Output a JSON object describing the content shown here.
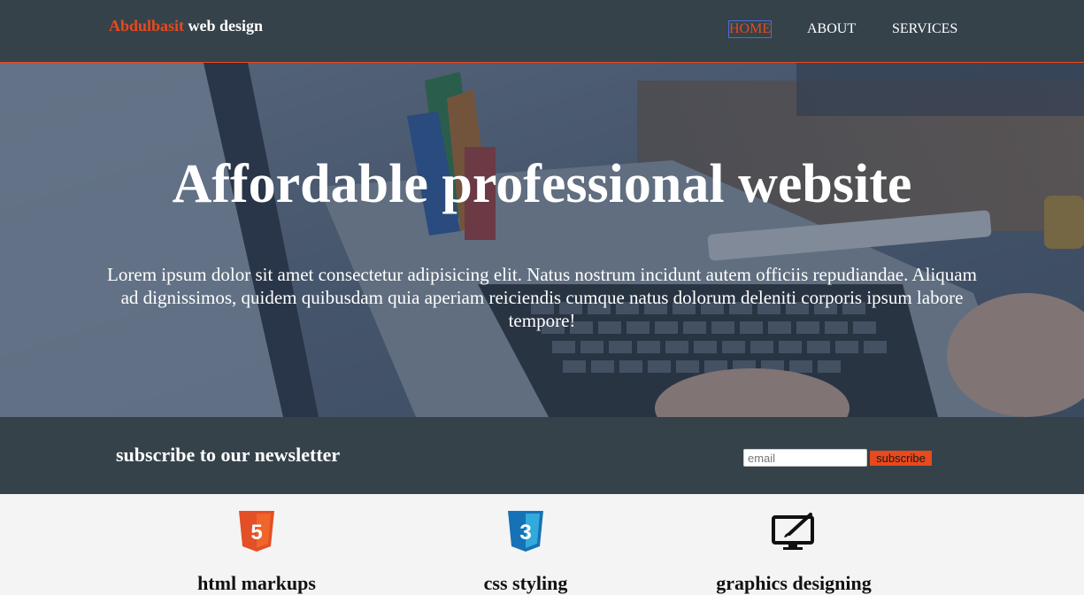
{
  "header": {
    "brand_highlight": "Abdulbasit",
    "brand_rest": " web design",
    "nav": [
      {
        "label": "HOME",
        "current": true
      },
      {
        "label": "ABOUT",
        "current": false
      },
      {
        "label": "SERVICES",
        "current": false
      }
    ]
  },
  "hero": {
    "title": "Affordable professional website",
    "text": "Lorem ipsum dolor sit amet consectetur adipisicing elit. Natus nostrum incidunt autem officiis repudiandae. Aliquam ad dignissimos, quidem quibusdam quia aperiam reiciendis cumque natus dolorum deleniti corporis ipsum labore tempore!"
  },
  "newsletter": {
    "heading": "subscribe to our newsletter",
    "email_placeholder": "email",
    "button_label": "subscribe"
  },
  "boxes": [
    {
      "icon": "html5-icon",
      "title": "html markups"
    },
    {
      "icon": "css3-icon",
      "title": "css styling"
    },
    {
      "icon": "graphics-monitor-icon",
      "title": "graphics designing"
    }
  ],
  "colors": {
    "dark": "#35424a",
    "accent": "#e8491d",
    "light": "#f4f4f4"
  }
}
